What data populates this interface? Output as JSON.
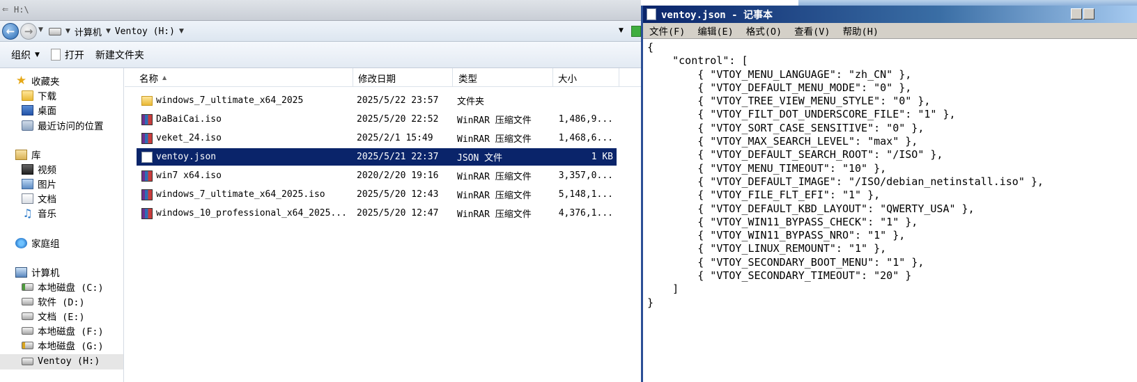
{
  "explorer": {
    "title_path": "H:\\",
    "breadcrumbs": [
      "计算机",
      "Ventoy (H:)"
    ],
    "toolbar": {
      "organize": "组织",
      "open": "打开",
      "new_folder": "新建文件夹"
    },
    "sidebar": {
      "favorites": "收藏夹",
      "downloads": "下载",
      "desktop": "桌面",
      "recent": "最近访问的位置",
      "libraries": "库",
      "videos": "视频",
      "pictures": "图片",
      "documents": "文档",
      "music": "音乐",
      "homegroup": "家庭组",
      "computer": "计算机",
      "drives": [
        "本地磁盘 (C:)",
        "软件 (D:)",
        "文档 (E:)",
        "本地磁盘 (F:)",
        "本地磁盘 (G:)",
        "Ventoy (H:)"
      ]
    },
    "columns": {
      "name": "名称",
      "date": "修改日期",
      "type": "类型",
      "size": "大小"
    },
    "files": [
      {
        "name": "windows_7_ultimate_x64_2025",
        "date": "2025/5/22 23:57",
        "type": "文件夹",
        "size": "",
        "icon": "folder-icon"
      },
      {
        "name": "DaBaiCai.iso",
        "date": "2025/5/20 22:52",
        "type": "WinRAR 压缩文件",
        "size": "1,486,9...",
        "icon": "winrar-icon"
      },
      {
        "name": "veket_24.iso",
        "date": "2025/2/1 15:49",
        "type": "WinRAR 压缩文件",
        "size": "1,468,6...",
        "icon": "winrar-icon"
      },
      {
        "name": "ventoy.json",
        "date": "2025/5/21 22:37",
        "type": "JSON 文件",
        "size": "1 KB",
        "icon": "text-file-icon"
      },
      {
        "name": "win7 x64.iso",
        "date": "2020/2/20 19:16",
        "type": "WinRAR 压缩文件",
        "size": "3,357,0...",
        "icon": "winrar-icon"
      },
      {
        "name": "windows_7_ultimate_x64_2025.iso",
        "date": "2025/5/20 12:43",
        "type": "WinRAR 压缩文件",
        "size": "5,148,1...",
        "icon": "winrar-icon"
      },
      {
        "name": "windows_10_professional_x64_2025...",
        "date": "2025/5/20 12:47",
        "type": "WinRAR 压缩文件",
        "size": "4,376,1...",
        "icon": "winrar-icon"
      }
    ],
    "selected_file_index": 3
  },
  "notepad": {
    "title": "ventoy.json - 记事本",
    "menus": [
      "文件(F)",
      "编辑(E)",
      "格式(O)",
      "查看(V)",
      "帮助(H)"
    ],
    "content": "{\n    \"control\": [\n        { \"VTOY_MENU_LANGUAGE\": \"zh_CN\" },\n        { \"VTOY_DEFAULT_MENU_MODE\": \"0\" },\n        { \"VTOY_TREE_VIEW_MENU_STYLE\": \"0\" },\n        { \"VTOY_FILT_DOT_UNDERSCORE_FILE\": \"1\" },\n        { \"VTOY_SORT_CASE_SENSITIVE\": \"0\" },\n        { \"VTOY_MAX_SEARCH_LEVEL\": \"max\" },\n        { \"VTOY_DEFAULT_SEARCH_ROOT\": \"/ISO\" },\n        { \"VTOY_MENU_TIMEOUT\": \"10\" },\n        { \"VTOY_DEFAULT_IMAGE\": \"/ISO/debian_netinstall.iso\" },\n        { \"VTOY_FILE_FLT_EFI\": \"1\" },\n        { \"VTOY_DEFAULT_KBD_LAYOUT\": \"QWERTY_USA\" },\n        { \"VTOY_WIN11_BYPASS_CHECK\": \"1\" },\n        { \"VTOY_WIN11_BYPASS_NRO\": \"1\" },\n        { \"VTOY_LINUX_REMOUNT\": \"1\" },\n        { \"VTOY_SECONDARY_BOOT_MENU\": \"1\" },\n        { \"VTOY_SECONDARY_TIMEOUT\": \"20\" }\n    ]\n}"
  },
  "colors": {
    "selection": "#0a246a",
    "notepad_title": "#0a246a",
    "menu_bg": "#d4d0c8"
  }
}
